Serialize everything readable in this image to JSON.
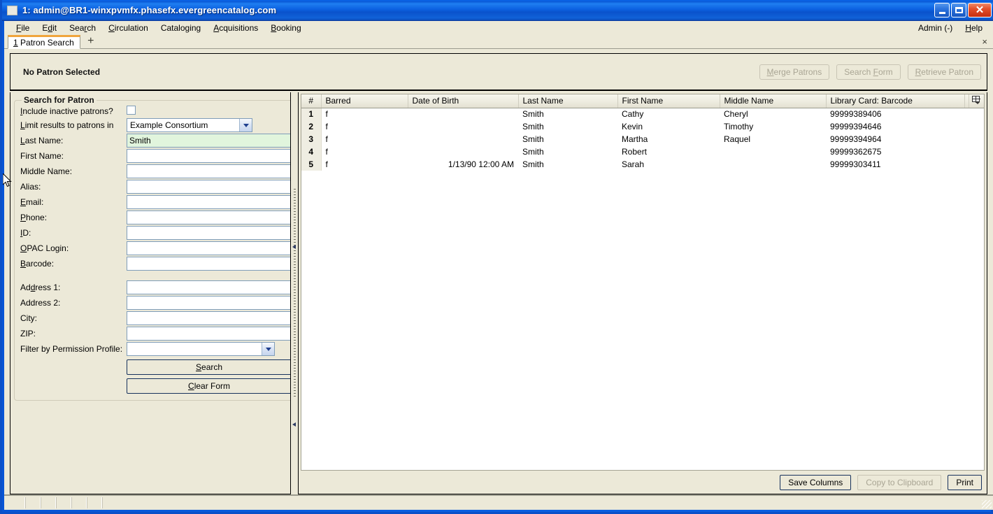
{
  "window": {
    "title": "1: admin@BR1-winxpvmfx.phasefx.evergreencatalog.com",
    "icon": "window-icon",
    "minimize_label": "",
    "maximize_label": "",
    "close_label": "✕"
  },
  "menubar": {
    "items": [
      {
        "label": "File",
        "accel": "F"
      },
      {
        "label": "Edit",
        "accel": "E"
      },
      {
        "label": "Search",
        "accel": "r"
      },
      {
        "label": "Circulation",
        "accel": "C"
      },
      {
        "label": "Cataloging",
        "accel": "g"
      },
      {
        "label": "Acquisitions",
        "accel": "A"
      },
      {
        "label": "Booking",
        "accel": "B"
      }
    ],
    "right_items": [
      {
        "label": "Admin (-)",
        "accel": ""
      },
      {
        "label": "Help",
        "accel": "H"
      }
    ]
  },
  "tabstrip": {
    "tabs": [
      {
        "number": "1",
        "label": "Patron Search",
        "active": true
      }
    ],
    "new_tab_label": "+",
    "close_all_label": "×"
  },
  "patron_header": {
    "title": "No Patron Selected",
    "buttons": [
      {
        "label": "Merge Patrons",
        "disabled": true
      },
      {
        "label": "Search Form",
        "disabled": true
      },
      {
        "label": "Retrieve Patron",
        "disabled": true
      }
    ]
  },
  "search_form": {
    "legend": "Search for Patron",
    "include_inactive_label": "Include inactive patrons?",
    "include_inactive_checked": false,
    "limit_label": "Limit results to patrons in",
    "limit_value": "Example Consortium",
    "fields": [
      {
        "label": "Last Name:",
        "value": "Smith",
        "placeholder": "",
        "active": true
      },
      {
        "label": "First Name:",
        "value": "",
        "placeholder": "",
        "active": false
      },
      {
        "label": "Middle Name:",
        "value": "",
        "placeholder": "",
        "active": false
      },
      {
        "label": "Alias:",
        "value": "",
        "placeholder": "",
        "active": false
      },
      {
        "label": "Email:",
        "value": "",
        "placeholder": "",
        "active": false
      },
      {
        "label": "Phone:",
        "value": "",
        "placeholder": "",
        "active": false
      },
      {
        "label": "ID:",
        "value": "",
        "placeholder": "",
        "active": false
      },
      {
        "label": "OPAC Login:",
        "value": "",
        "placeholder": "",
        "active": false
      },
      {
        "label": "Barcode:",
        "value": "",
        "placeholder": "",
        "active": false
      }
    ],
    "address_fields": [
      {
        "label": "Address 1:",
        "value": "",
        "placeholder": ""
      },
      {
        "label": "Address 2:",
        "value": "",
        "placeholder": ""
      },
      {
        "label": "City:",
        "value": "",
        "placeholder": ""
      },
      {
        "label": "ZIP:",
        "value": "",
        "placeholder": ""
      }
    ],
    "profile_label": "Filter by Permission Profile:",
    "profile_value": "",
    "search_button": "Search",
    "clear_button": "Clear Form"
  },
  "results": {
    "columns": [
      {
        "key": "num",
        "label": "#"
      },
      {
        "key": "barred",
        "label": "Barred"
      },
      {
        "key": "dob",
        "label": "Date of Birth"
      },
      {
        "key": "last",
        "label": "Last Name"
      },
      {
        "key": "first",
        "label": "First Name"
      },
      {
        "key": "middle",
        "label": "Middle Name"
      },
      {
        "key": "barcode",
        "label": "Library Card: Barcode"
      }
    ],
    "column_picker_icon": "column-picker-icon",
    "rows": [
      {
        "num": "1",
        "barred": "f",
        "dob": "",
        "last": "Smith",
        "first": "Cathy",
        "middle": "Cheryl",
        "barcode": "99999389406"
      },
      {
        "num": "2",
        "barred": "f",
        "dob": "",
        "last": "Smith",
        "first": "Kevin",
        "middle": "Timothy",
        "barcode": "99999394646"
      },
      {
        "num": "3",
        "barred": "f",
        "dob": "",
        "last": "Smith",
        "first": "Martha",
        "middle": "Raquel",
        "barcode": "99999394964"
      },
      {
        "num": "4",
        "barred": "f",
        "dob": "",
        "last": "Smith",
        "first": "Robert",
        "middle": "",
        "barcode": "99999362675"
      },
      {
        "num": "5",
        "barred": "f",
        "dob": "1/13/90 12:00 AM",
        "last": "Smith",
        "first": "Sarah",
        "middle": "",
        "barcode": "99999303411"
      }
    ],
    "footer_buttons": [
      {
        "label": "Save Columns",
        "disabled": false
      },
      {
        "label": "Copy to Clipboard",
        "disabled": true
      },
      {
        "label": "Print",
        "disabled": false
      }
    ]
  },
  "statusbar": {
    "cells": [
      "",
      "",
      "",
      "",
      "",
      ""
    ]
  },
  "colors": {
    "titlebar_blue": "#0a5fe0",
    "window_bg": "#ece9d8",
    "active_field_green": "#e1f5dd",
    "tab_accent_orange": "#f0a53c",
    "button_border_navy": "#16315c",
    "disabled_text": "#a9a594"
  }
}
